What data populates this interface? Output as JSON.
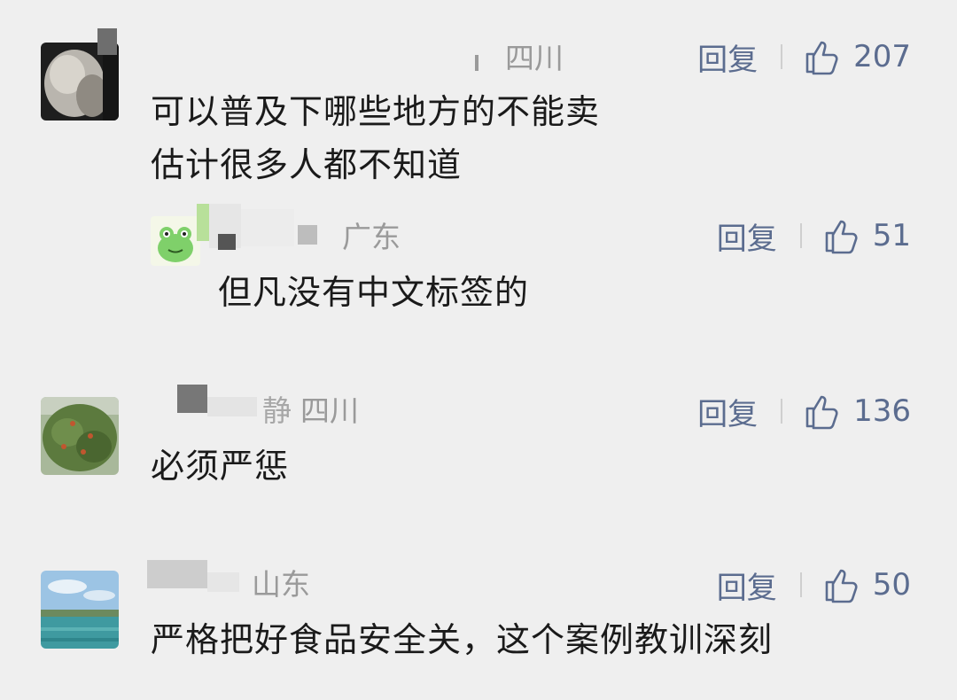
{
  "comments": [
    {
      "name_fragment": "",
      "location": "四川",
      "reply_label": "回复",
      "likes": "207",
      "lines": [
        "可以普及下哪些地方的不能卖",
        "估计很多人都不知道"
      ],
      "reply": {
        "name_fragment": "",
        "location": "广东",
        "reply_label": "回复",
        "likes": "51",
        "text": "但凡没有中文标签的"
      }
    },
    {
      "name_fragment": "静",
      "location": "四川",
      "reply_label": "回复",
      "likes": "136",
      "lines": [
        "必须严惩"
      ]
    },
    {
      "name_fragment": "",
      "location": "山东",
      "reply_label": "回复",
      "likes": "50",
      "lines": [
        "严格把好食品安全关，这个案例教训深刻"
      ]
    }
  ],
  "colors": {
    "background": "#efefef",
    "link": "#5b6c8f",
    "meta": "#9a9a9a",
    "text": "#1a1a1a"
  }
}
